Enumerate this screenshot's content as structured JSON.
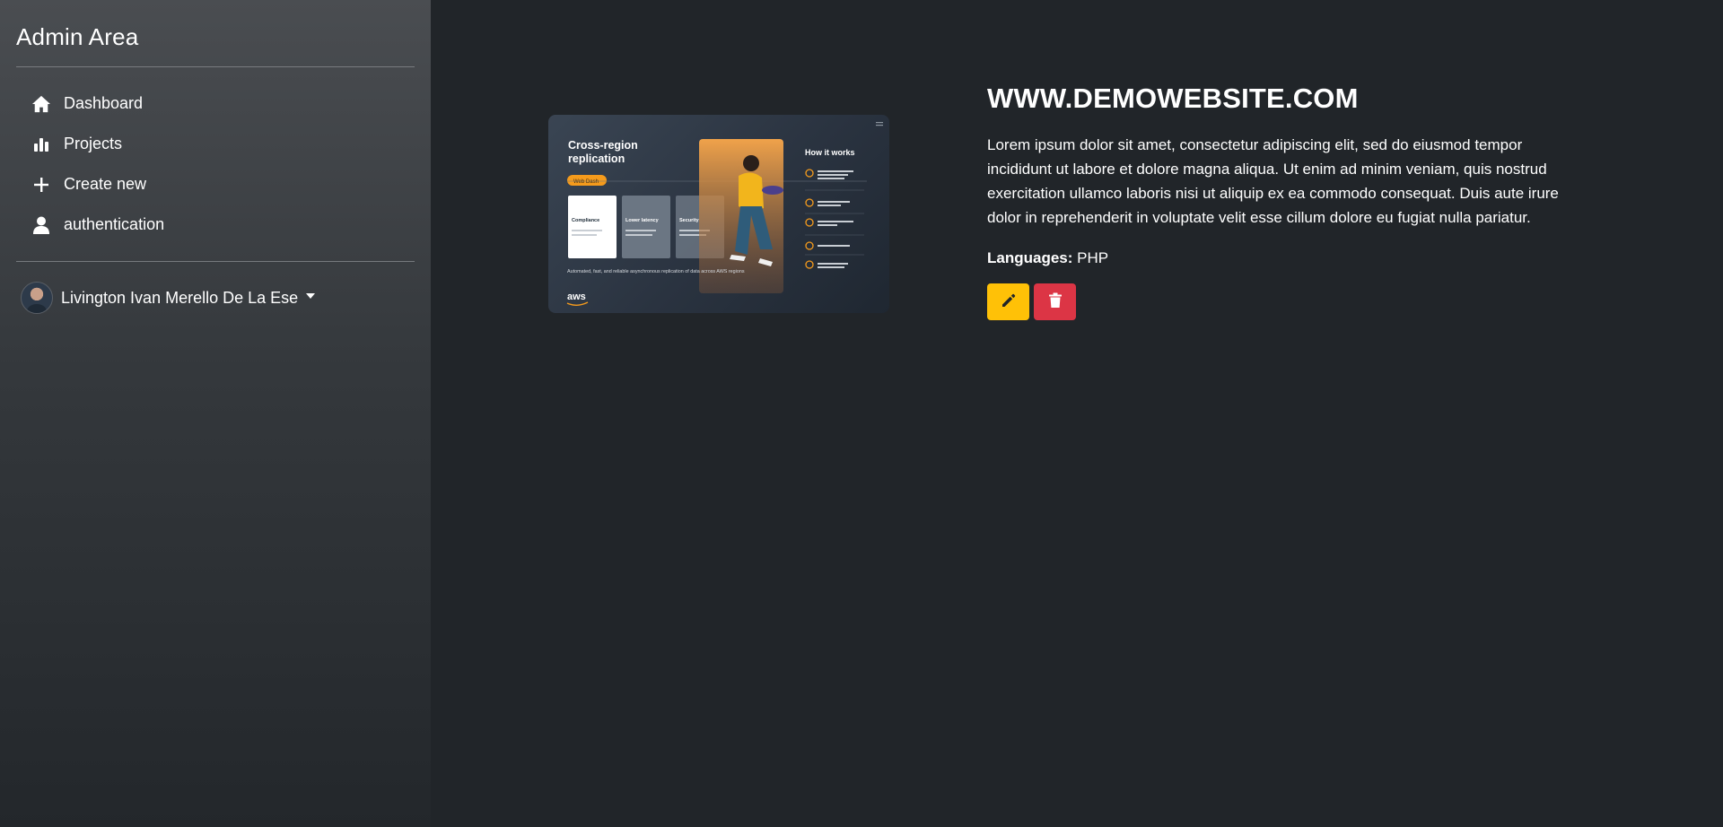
{
  "sidebar": {
    "brand": "Admin Area",
    "items": [
      {
        "label": "Dashboard",
        "icon": "home-icon"
      },
      {
        "label": "Projects",
        "icon": "bar-chart-icon"
      },
      {
        "label": "Create new",
        "icon": "plus-icon"
      },
      {
        "label": "authentication",
        "icon": "user-icon"
      }
    ],
    "user": {
      "name": "Livington Ivan Merello De La Ese",
      "icon": "chevron-down-icon"
    }
  },
  "project": {
    "title": "WWW.DEMOWEBSITE.COM",
    "description": "Lorem ipsum dolor sit amet, consectetur adipiscing elit, sed do eiusmod tempor incididunt ut labore et dolore magna aliqua. Ut enim ad minim veniam, quis nostrud exercitation ullamco laboris nisi ut aliquip ex ea commodo consequat. Duis aute irure dolor in reprehenderit in voluptate velit esse cillum dolore eu fugiat nulla pariatur.",
    "languages_label": "Languages:",
    "languages_value": "PHP",
    "image": {
      "heading": "Cross-region replication",
      "pill": "Web Dash",
      "cards": [
        "Compliance",
        "Lower latency",
        "Security"
      ],
      "how_heading": "How it works",
      "footer": "Automated, fast, and reliable asynchronous replication of data across AWS regions",
      "logo": "aws"
    }
  },
  "actions": {
    "edit_icon": "pencil-icon",
    "delete_icon": "trash-icon"
  },
  "colors": {
    "background": "#212529",
    "edit": "#ffc107",
    "delete": "#dc3545"
  }
}
